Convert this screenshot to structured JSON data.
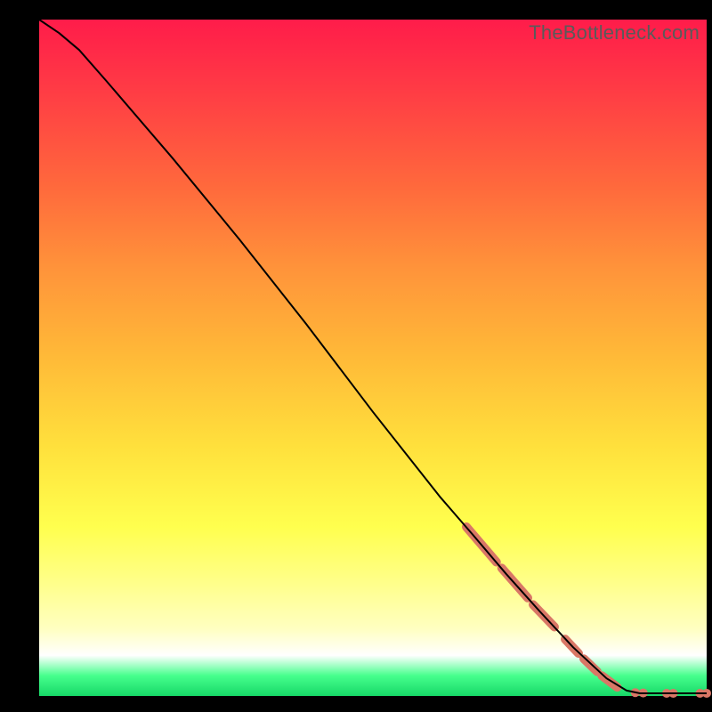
{
  "watermark": "TheBottleneck.com",
  "chart_data": {
    "type": "line",
    "title": "",
    "xlabel": "",
    "ylabel": "",
    "xlim": [
      0,
      100
    ],
    "ylim": [
      0,
      100
    ],
    "curve": [
      {
        "x": 0,
        "y": 100
      },
      {
        "x": 3,
        "y": 98
      },
      {
        "x": 6,
        "y": 95.5
      },
      {
        "x": 10,
        "y": 91
      },
      {
        "x": 20,
        "y": 79.5
      },
      {
        "x": 30,
        "y": 67.5
      },
      {
        "x": 40,
        "y": 55
      },
      {
        "x": 50,
        "y": 42
      },
      {
        "x": 60,
        "y": 29.5
      },
      {
        "x": 65,
        "y": 23.8
      },
      {
        "x": 70,
        "y": 18
      },
      {
        "x": 75,
        "y": 12.5
      },
      {
        "x": 80,
        "y": 7.2
      },
      {
        "x": 85,
        "y": 2.6
      },
      {
        "x": 88,
        "y": 0.8
      },
      {
        "x": 90,
        "y": 0.4
      },
      {
        "x": 95,
        "y": 0.4
      },
      {
        "x": 100,
        "y": 0.4
      }
    ],
    "marker_segments": [
      {
        "x1": 64,
        "y1": 25.0,
        "x2": 68.5,
        "y2": 19.8
      },
      {
        "x1": 69.3,
        "y1": 18.9,
        "x2": 73.2,
        "y2": 14.5
      },
      {
        "x1": 74.0,
        "y1": 13.5,
        "x2": 77.2,
        "y2": 10.2
      },
      {
        "x1": 78.8,
        "y1": 8.4,
        "x2": 80.8,
        "y2": 6.3
      },
      {
        "x1": 81.6,
        "y1": 5.5,
        "x2": 83.6,
        "y2": 3.6
      },
      {
        "x1": 84.3,
        "y1": 3.0,
        "x2": 86.6,
        "y2": 1.3
      }
    ],
    "marker_dots": [
      {
        "x": 89.3,
        "y": 0.5
      },
      {
        "x": 90.5,
        "y": 0.45
      },
      {
        "x": 94.0,
        "y": 0.4
      },
      {
        "x": 95.0,
        "y": 0.4
      },
      {
        "x": 99.0,
        "y": 0.4
      },
      {
        "x": 100.0,
        "y": 0.4
      }
    ],
    "marker_color": "#d97766",
    "marker_width": 10
  }
}
